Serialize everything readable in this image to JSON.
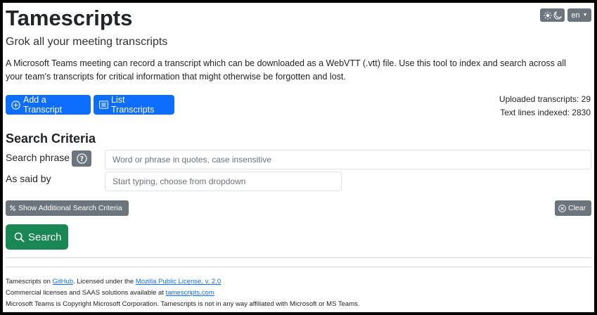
{
  "header": {
    "title": "Tamescripts",
    "subtitle": "Grok all your meeting transcripts",
    "theme_toggle_icons": [
      "sun-icon",
      "moon-icon"
    ],
    "language": "en"
  },
  "intro": "A Microsoft Teams meeting can record a transcript which can be downloaded as a WebVTT (.vtt) file. Use this tool to index and search across all your team's transcripts for critical information that might otherwise be forgotten and lost.",
  "actions": {
    "add_label": "Add a Transcript",
    "list_label": "List Transcripts"
  },
  "stats": {
    "uploaded": "Uploaded transcripts: 29",
    "indexed": "Text lines indexed: 2830"
  },
  "search": {
    "heading": "Search Criteria",
    "phrase_label": "Search phrase",
    "phrase_placeholder": "Word or phrase in quotes, case insensitive",
    "said_by_label": "As said by",
    "said_by_placeholder": "Start typing, choose from dropdown",
    "show_more_label": "Show Additional Search Criteria",
    "clear_label": "Clear",
    "search_label": "Search"
  },
  "footer": {
    "line1_pre": "Tamescripts on ",
    "line1_link1": "GitHub",
    "line1_mid": ". Licensed under the ",
    "line1_link2": "Mozilla Public License, v. 2.0",
    "line2_pre": "Commercial licenses and SAAS solutions available at ",
    "line2_link": "tamescripts.com",
    "line3": "Microsoft Teams is Copyright Microsoft Corporation. Tamescripts is not in any way affiliated with Microsoft or MS Teams."
  },
  "colors": {
    "primary": "#0d6efd",
    "secondary": "#6c757d",
    "success": "#198754"
  }
}
